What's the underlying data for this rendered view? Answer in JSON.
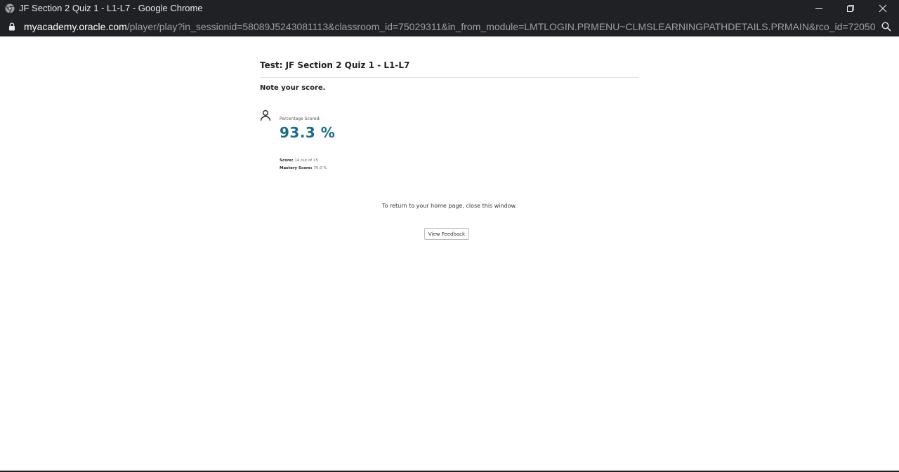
{
  "window": {
    "title": "JF Section 2 Quiz 1 - L1-L7 - Google Chrome",
    "browser_icon": "chrome-logo-icon",
    "controls": [
      "minimize-icon",
      "restore-icon",
      "close-icon"
    ]
  },
  "addressbar": {
    "domain": "myacademy.oracle.com",
    "path": "/player/play?in_sessionid=58089J5243081113&classroom_id=75029311&in_from_module=LMTLOGIN.PRMENU~CLMSLEARNINGPATHDETAILS.PRMAIN&rco_id=72050704...",
    "lock_icon": "lock-icon",
    "zoom_icon": "zoom-icon"
  },
  "page": {
    "test_title": "Test: JF Section 2 Quiz 1 - L1-L7",
    "note": "Note your score.",
    "percentage_label": "Percentage Scored:",
    "percentage_value": "93.3 %",
    "score_label": "Score:",
    "score_value": "14 out of 15",
    "mastery_label": "Mastery Score:",
    "mastery_value": "70.0 %",
    "return_text": "To return to your home page, close this window.",
    "feedback_button": "View Feedback"
  },
  "colors": {
    "chrome_bar": "#202124",
    "score_accent": "#1f6b88"
  }
}
